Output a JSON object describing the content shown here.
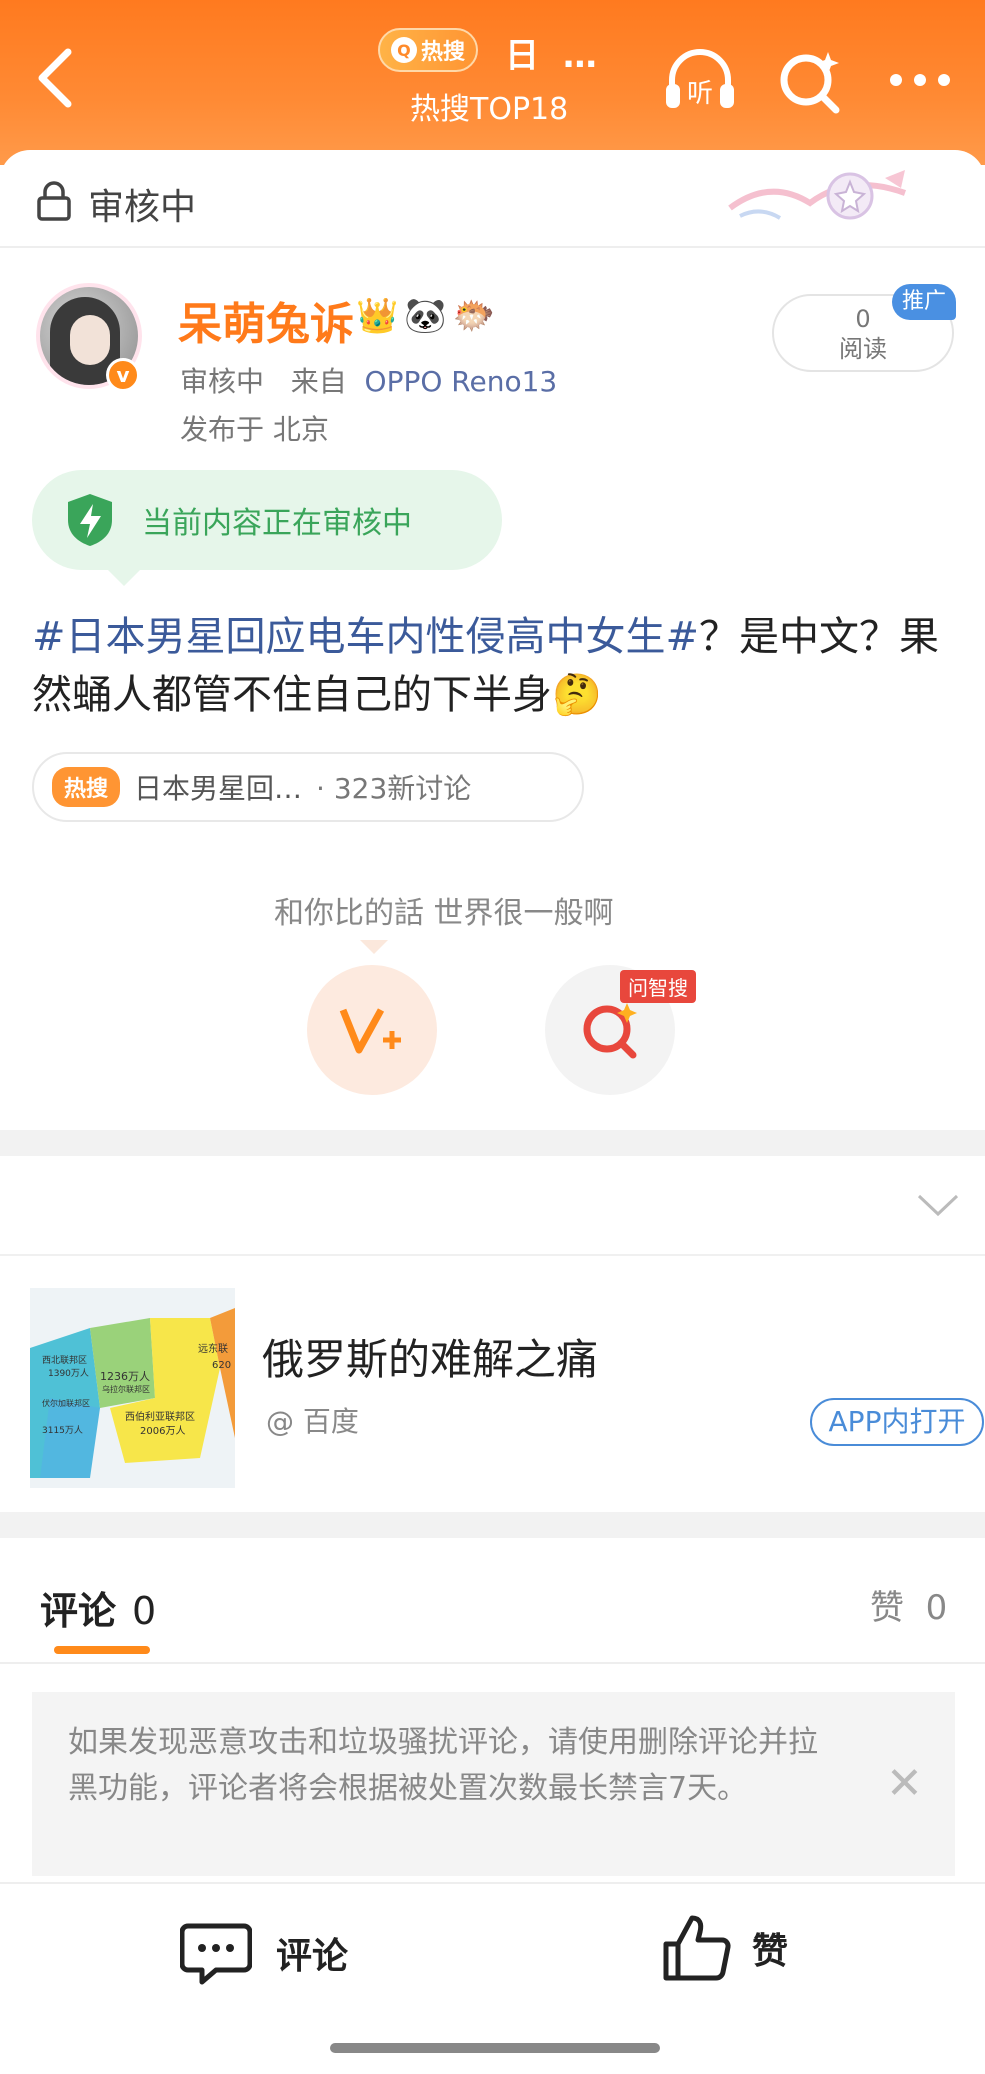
{
  "header": {
    "hot_badge": "热搜",
    "hot_extra": "日 …",
    "title": "热搜TOP18",
    "listen_label": "听"
  },
  "review": {
    "label": "审核中"
  },
  "author": {
    "name": "呆萌兔诉",
    "badges": [
      "👑",
      "🐼",
      "🐡"
    ],
    "status": "审核中",
    "from_label": "来自",
    "device": "OPPO Reno13",
    "location": "发布于 北京"
  },
  "reads": {
    "count": "0",
    "label": "阅读"
  },
  "promo": "推广",
  "audit_notice": "当前内容正在审核中",
  "post": {
    "hashtag": "#日本男星回应电车内性侵高中女生#",
    "text": "？是中文？果然蛹人都管不住自己的下半身🤔"
  },
  "topic": {
    "badge": "热搜",
    "text": "日本男星回…",
    "count": "· 323新讨论"
  },
  "quote": "和你比的話 世界很一般啊",
  "ask_badge": "问智搜",
  "card": {
    "title": "俄罗斯的难解之痛",
    "source": "@ 百度",
    "open_button": "APP内打开",
    "map_labels": [
      "西北联邦区",
      "1390万人",
      "1236万人",
      "乌拉尔联邦区",
      "伏尔加联邦区",
      "3115万人",
      "西伯利亚联邦区",
      "2006万人",
      "远东联",
      "620"
    ]
  },
  "tabs": {
    "comment_label": "评论",
    "comment_count": "0",
    "like_label": "赞",
    "like_count": "0"
  },
  "notice": "如果发现恶意攻击和垃圾骚扰评论，请使用删除评论并拉黑功能，评论者将会根据被处置次数最长禁言7天。",
  "bottom": {
    "comment": "评论",
    "like": "赞"
  },
  "colors": {
    "accent": "#ff7a1a",
    "link": "#3b5a9a",
    "audit_green": "#3aa55a"
  }
}
